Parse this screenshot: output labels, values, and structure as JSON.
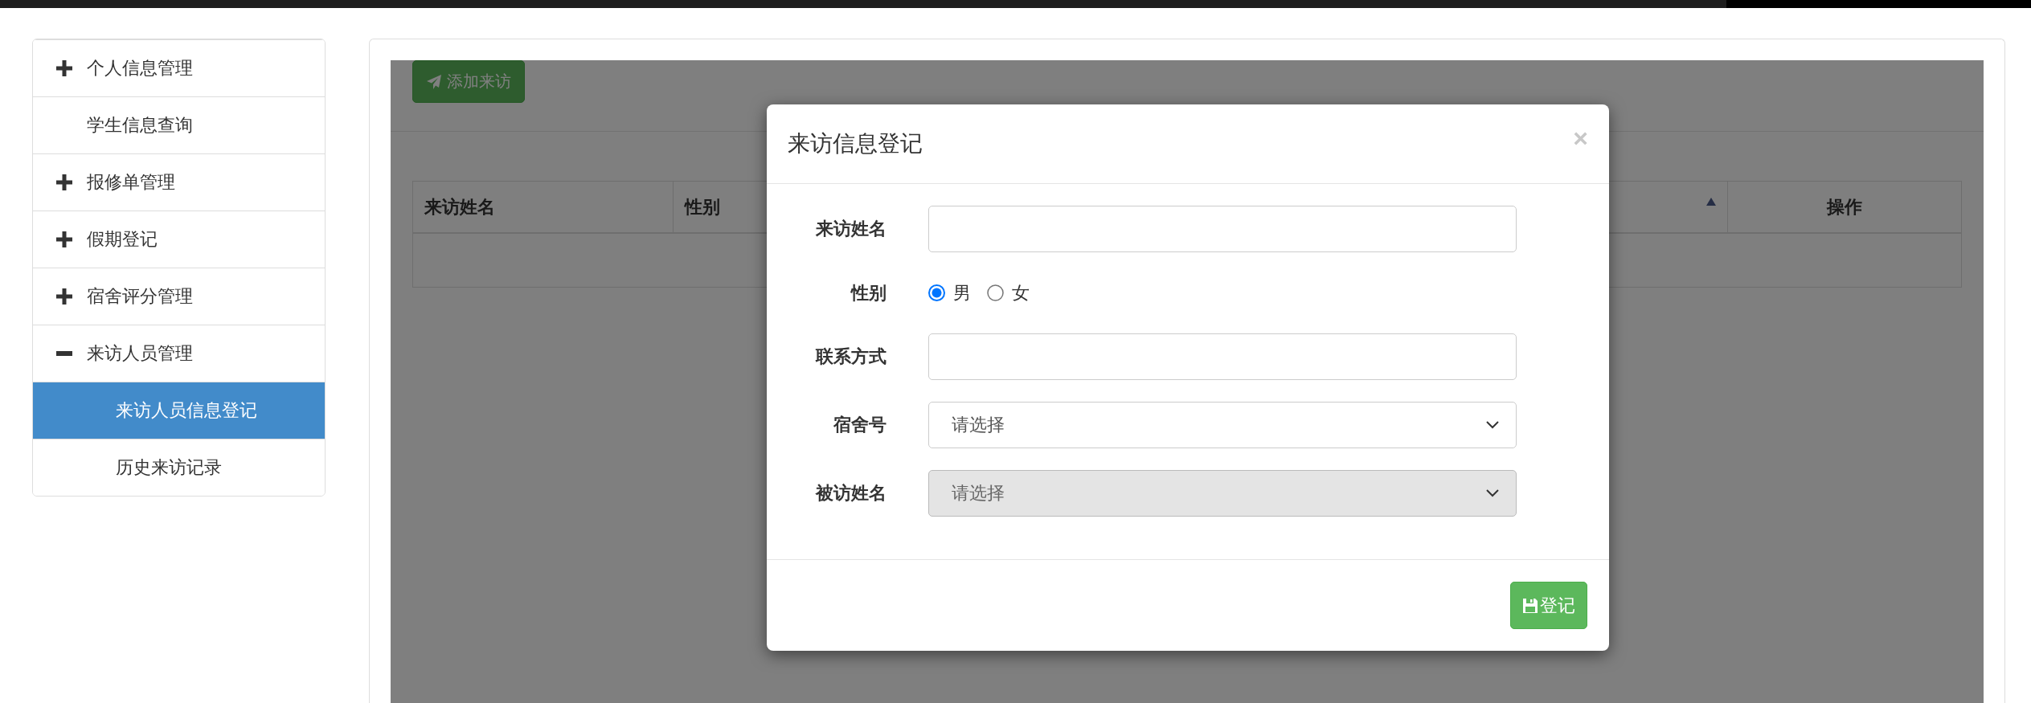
{
  "sidebar": {
    "items": [
      {
        "label": "个人信息管理",
        "kind": "group",
        "expanded": false
      },
      {
        "label": "学生信息查询",
        "kind": "link",
        "selected": false
      },
      {
        "label": "报修单管理",
        "kind": "group",
        "expanded": false
      },
      {
        "label": "假期登记",
        "kind": "group",
        "expanded": false
      },
      {
        "label": "宿舍评分管理",
        "kind": "group",
        "expanded": false
      },
      {
        "label": "来访人员管理",
        "kind": "group",
        "expanded": true,
        "children": [
          {
            "label": "来访人员信息登记",
            "selected": true
          },
          {
            "label": "历史来访记录",
            "selected": false
          }
        ]
      }
    ]
  },
  "toolbar": {
    "add_button": "添加来访"
  },
  "table": {
    "columns": [
      {
        "label": "来访姓名",
        "sorted": false
      },
      {
        "label": "性别",
        "sorted": false
      },
      {
        "sorted": true
      },
      {
        "label": "操作",
        "sorted": false
      }
    ]
  },
  "modal": {
    "title": "来访信息登记",
    "close": "×",
    "fields": [
      {
        "kind": "text",
        "label": "来访姓名"
      },
      {
        "kind": "radio",
        "label": "性别",
        "options": [
          {
            "label": "男",
            "selected": true
          },
          {
            "label": "女",
            "selected": false
          }
        ]
      },
      {
        "kind": "text",
        "label": "联系方式"
      },
      {
        "kind": "select",
        "label": "宿舍号",
        "value": "请选择",
        "disabled": false
      },
      {
        "kind": "select",
        "label": "被访姓名",
        "value": "请选择",
        "disabled": true
      }
    ],
    "submit": "登记"
  }
}
